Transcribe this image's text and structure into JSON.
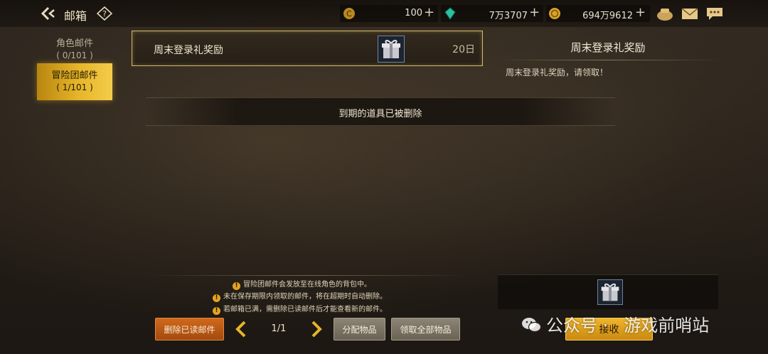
{
  "header": {
    "title": "邮箱",
    "currencies": [
      {
        "icon": "gold-coin-c-icon",
        "value": "100"
      },
      {
        "icon": "green-gem-icon",
        "value": "7万3707"
      },
      {
        "icon": "gold-coin-icon",
        "value": "694万9612"
      }
    ],
    "icons": [
      "bag-icon",
      "mail-icon",
      "chat-bubble-icon"
    ]
  },
  "sidebar": {
    "tabs": [
      {
        "label": "角色邮件",
        "count": "( 0/101 )",
        "selected": false
      },
      {
        "label": "冒险团邮件",
        "count": "( 1/101 )",
        "selected": true
      }
    ]
  },
  "mail_list": {
    "items": [
      {
        "title": "周末登录礼奖励",
        "icon": "gift-box-icon",
        "days": "20日",
        "selected": true
      }
    ],
    "expired_notice": "到期的道具已被删除"
  },
  "detail": {
    "title": "周末登录礼奖励",
    "body": "周末登录礼奖励，请领取！",
    "reward_icon": "gift-box-icon"
  },
  "notices": [
    "冒险团邮件会发放至在线角色的背包中。",
    "未在保存期限内领取的邮件，将在超期时自动删除。",
    "若邮箱已满，需删除已读邮件后才能查看新的邮件。"
  ],
  "footer": {
    "delete_read": "删除已读邮件",
    "page": "1/1",
    "assign_items": "分配物品",
    "claim_all": "领取全部物品",
    "receive": "接收"
  },
  "watermark": {
    "prefix": "公众号 ·",
    "name": "游戏前哨站"
  },
  "colors": {
    "accent_gold": "#e6b52a",
    "delete_orange": "#c25d16",
    "frame_gold": "#d6b66a"
  }
}
